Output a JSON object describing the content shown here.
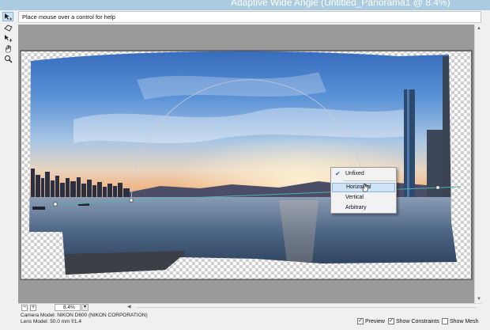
{
  "window": {
    "title": "Adaptive Wide Angle (Untitled_Panorama1 @ 8.4%)"
  },
  "toolbar": {
    "tools": [
      {
        "name": "constraint-tool",
        "icon": "constraint-arrow-icon",
        "active": true
      },
      {
        "name": "polygon-constraint-tool",
        "icon": "polygon-constraint-icon",
        "active": false
      },
      {
        "name": "move-tool",
        "icon": "move-icon",
        "active": false
      },
      {
        "name": "hand-tool",
        "icon": "hand-icon",
        "active": false
      },
      {
        "name": "zoom-tool",
        "icon": "zoom-icon",
        "active": false
      }
    ]
  },
  "help": {
    "text": "Place mouse over a control for help"
  },
  "context_menu": {
    "items": [
      {
        "label": "Unfixed",
        "checked": true,
        "highlighted": false
      },
      {
        "label": "Horizontal",
        "checked": false,
        "highlighted": true
      },
      {
        "label": "Vertical",
        "checked": false,
        "highlighted": false
      },
      {
        "label": "Arbitrary",
        "checked": false,
        "highlighted": false
      }
    ]
  },
  "zoom": {
    "minus": "−",
    "plus": "+",
    "value": "8.4%",
    "dropdown": "▾"
  },
  "info": {
    "camera": "Camera Model: NIKON D600 (NIKON CORPORATION)",
    "lens": "Lens Model: 50.0 mm f/1.4"
  },
  "options": {
    "preview": {
      "label": "Preview",
      "checked": true
    },
    "show_constraints": {
      "label": "Show Constraints",
      "checked": true
    },
    "show_mesh": {
      "label": "Show Mesh",
      "checked": false
    }
  },
  "colors": {
    "accent": "#2266bb",
    "title_bar": "#aacbe0",
    "canvas_bg": "#9a9a9a",
    "constraint_line": "#4fb4a8"
  }
}
